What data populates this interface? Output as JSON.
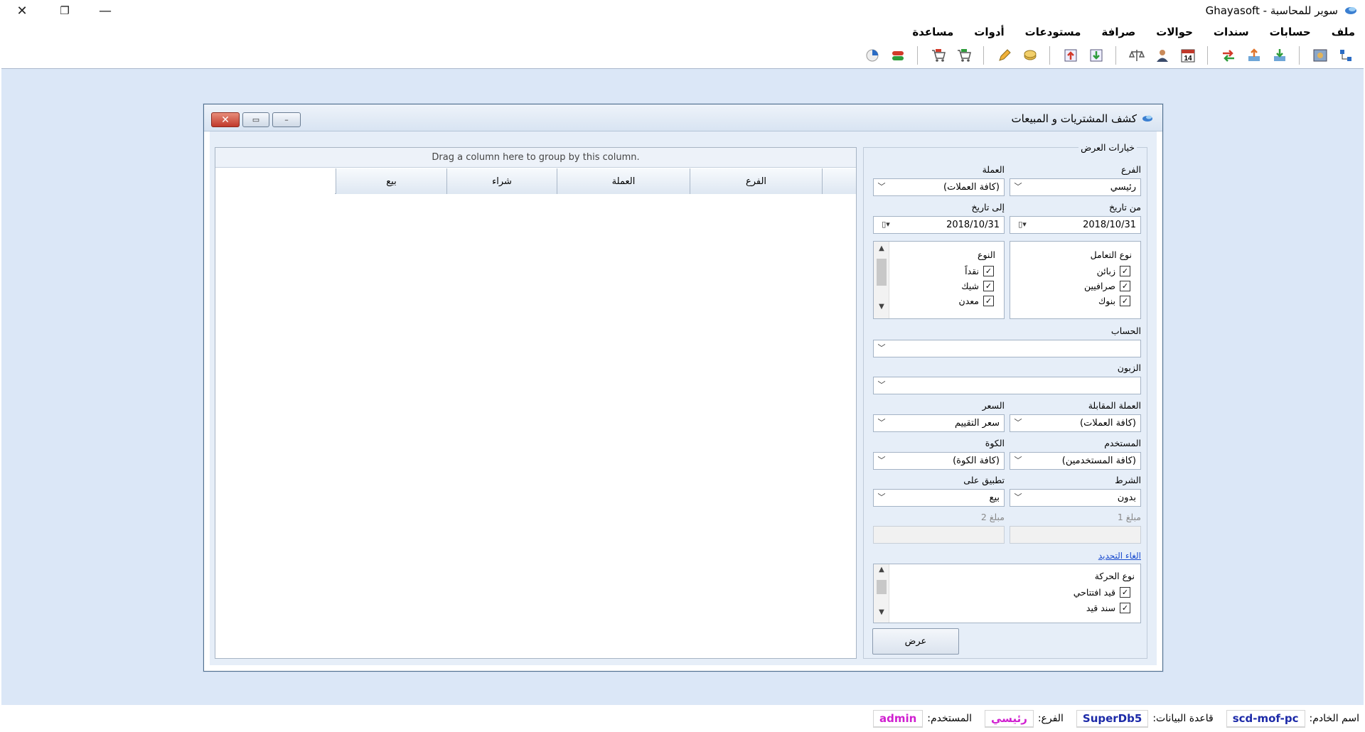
{
  "window": {
    "title": "سوبر للمحاسبة - Ghayasoft",
    "close_glyph": "✕",
    "restore_glyph": "❐",
    "minimize_glyph": "—"
  },
  "menu": [
    "ملف",
    "حسابات",
    "سندات",
    "حوالات",
    "صرافة",
    "مستودعات",
    "أدوات",
    "مساعدة"
  ],
  "toolbar": {
    "icons": [
      "tree-icon",
      "photo-icon",
      "download-icon",
      "upload-icon",
      "transfer-icon",
      "calendar-icon",
      "user-icon",
      "scale-icon",
      "import-icon",
      "export-icon",
      "coins-icon",
      "pencil-icon",
      "cart-icon",
      "cart-cancel-icon",
      "flag-icon",
      "pie-chart-icon"
    ],
    "calendar_day": "14"
  },
  "child": {
    "title": "كشف المشتريات و المبيعات",
    "close_glyph": "✕",
    "restore_glyph": "▭",
    "minimize_glyph": "–"
  },
  "grid": {
    "group_hint": "Drag a column here to group by this column.",
    "columns": [
      "الفرع",
      "العملة",
      "شراء",
      "بيع"
    ]
  },
  "options": {
    "legend": "خيارات العرض",
    "branch_label": "الفرع",
    "branch_value": "رئيسي",
    "currency_label": "العملة",
    "currency_value": "(كافة العملات)",
    "from_date_label": "من تاريخ",
    "from_date_value": "2018/10/31",
    "to_date_label": "إلى تاريخ",
    "to_date_value": "2018/10/31",
    "deal_type": {
      "header": "نوع التعامل",
      "items": [
        "زبائن",
        "صرافيين",
        "بنوك"
      ]
    },
    "kind": {
      "header": "النوع",
      "items": [
        "نقداً",
        "شيك",
        "معدن"
      ]
    },
    "account_label": "الحساب",
    "account_value": "",
    "customer_label": "الزبون",
    "customer_value": "",
    "counter_currency_label": "العملة المقابلة",
    "counter_currency_value": "(كافة العملات)",
    "price_label": "السعر",
    "price_value": "سعر التقييم",
    "user_label": "المستخدم",
    "user_value": "(كافة المستخدمين)",
    "window_label": "الكوة",
    "window_value": "(كافة الكوة)",
    "condition_label": "الشرط",
    "condition_value": "بدون",
    "apply_label": "تطبيق على",
    "apply_value": "بيع",
    "amount1_label": "مبلغ 1",
    "amount2_label": "مبلغ 2",
    "clear_selection": "الغاء التحديد",
    "movement_type": {
      "header": "نوع الحركة",
      "items": [
        "قيد افتتاحي",
        "سند قيد"
      ]
    },
    "show_button": "عرض",
    "check_mark": "✓"
  },
  "status": {
    "server_label": "اسم الخادم:",
    "server_value": "scd-mof-pc",
    "db_label": "قاعدة البيانات:",
    "db_value": "SuperDb5",
    "branch_label": "الفرع:",
    "branch_value": "رئيسي",
    "user_label": "المستخدم:",
    "user_value": "admin"
  },
  "colors": {
    "workspace": "#dbe7f7",
    "status_server": "#1c2aa8",
    "status_db": "#1c2aa8",
    "status_branch": "#d01fd0",
    "status_user": "#d01fd0"
  }
}
